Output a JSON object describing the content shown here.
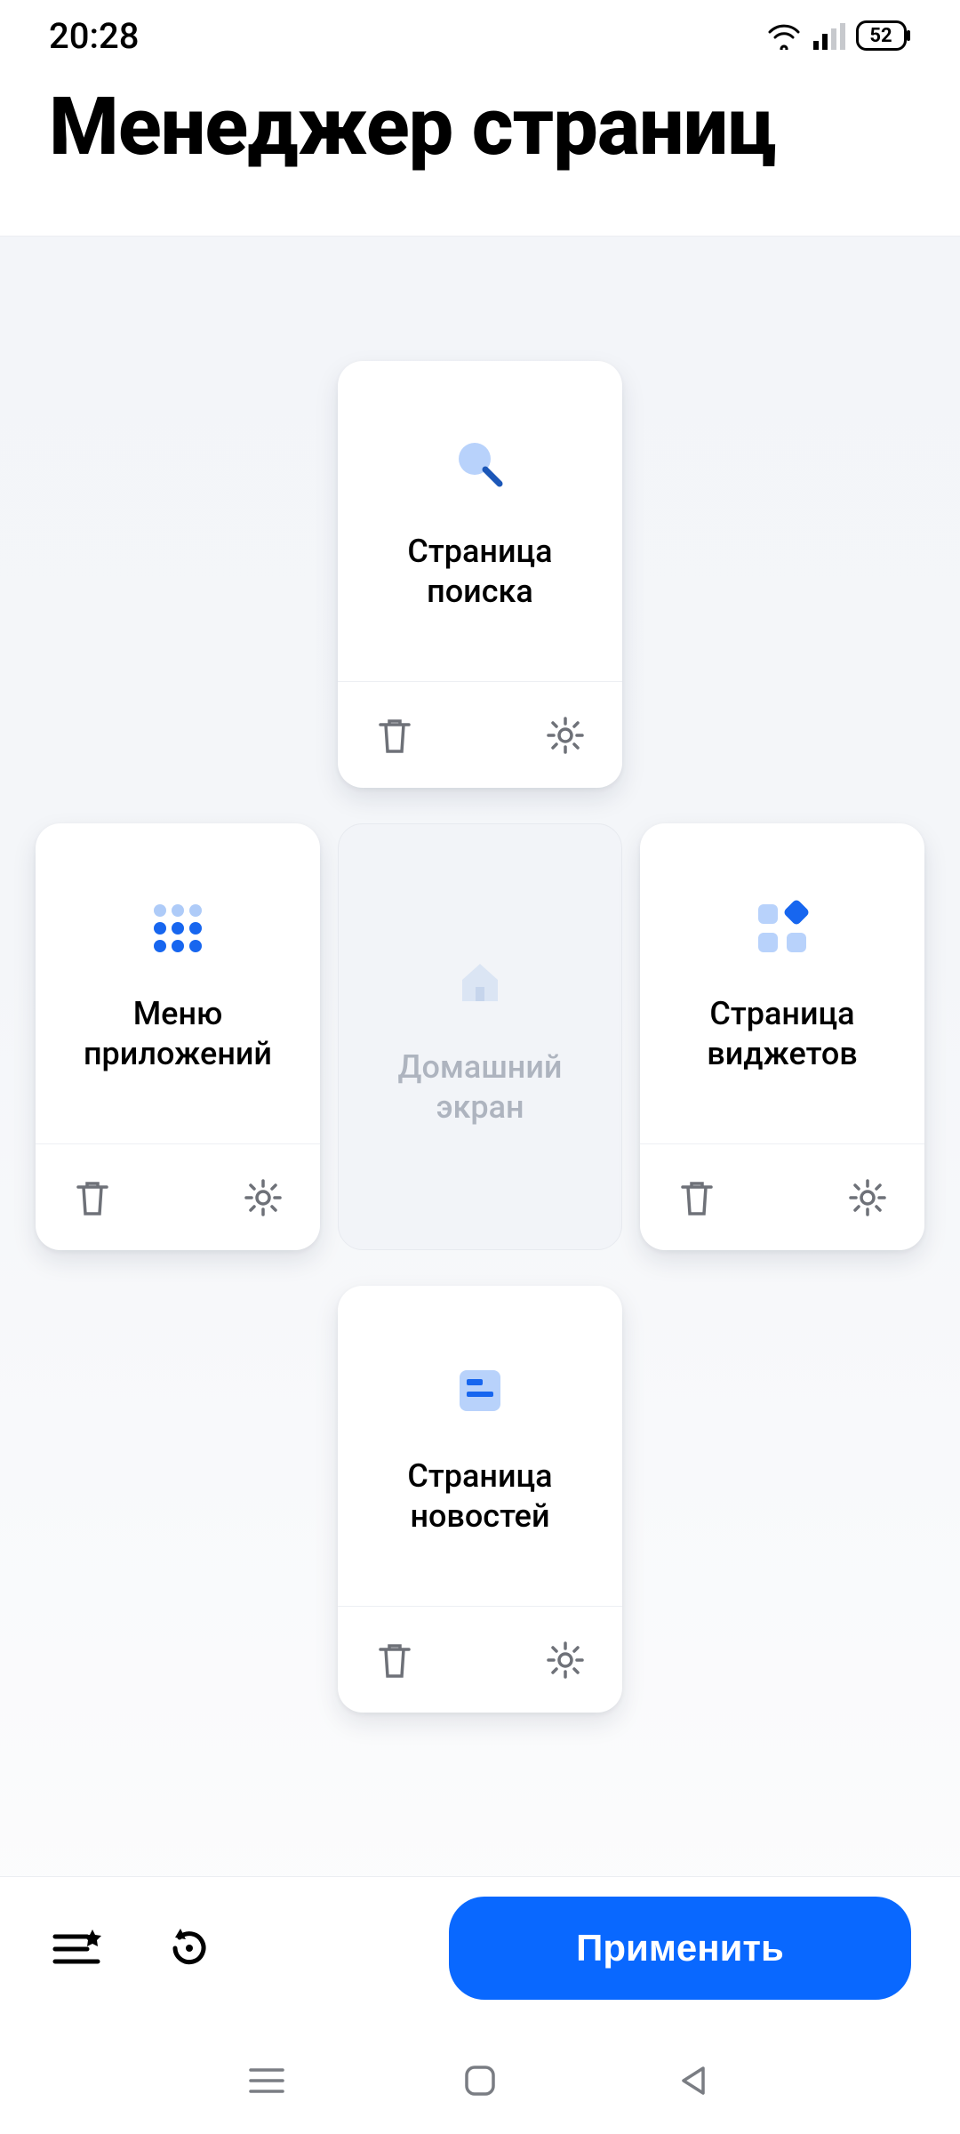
{
  "status": {
    "time": "20:28",
    "battery": "52"
  },
  "header": {
    "title": "Менеджер страниц"
  },
  "cards": {
    "search": {
      "label": "Страница поиска"
    },
    "apps": {
      "label": "Меню приложений"
    },
    "home": {
      "label": "Домашний экран"
    },
    "widgets": {
      "label": "Страница виджетов"
    },
    "news": {
      "label": "Страница новостей"
    }
  },
  "actions": {
    "apply": "Применить"
  }
}
